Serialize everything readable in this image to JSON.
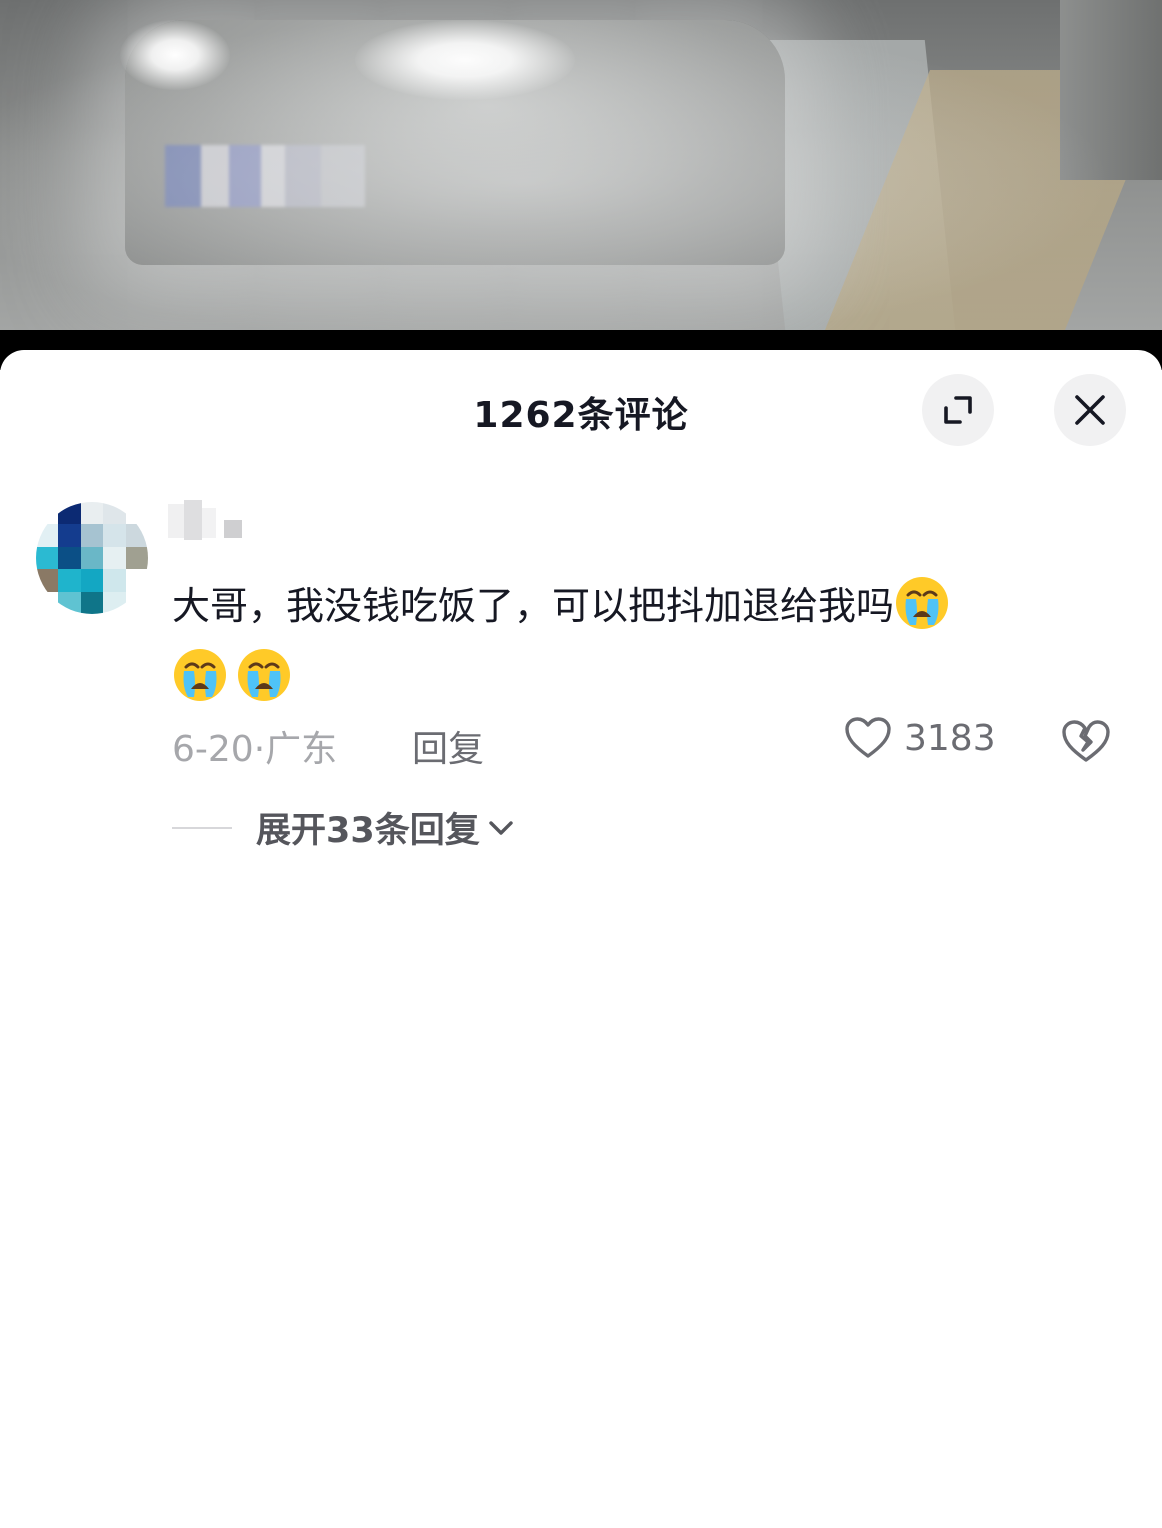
{
  "comments_panel": {
    "title": "1262条评论",
    "expand_icon": "expand-icon",
    "close_icon": "close-icon"
  },
  "comment": {
    "text": "大哥，我没钱吃饭了，可以把抖加退给我吗",
    "emoji": "loudly-crying-face",
    "date": "6-20",
    "separator": "·",
    "location": "广东",
    "reply_label": "回复",
    "like_count": "3183",
    "like_icon": "heart-icon",
    "dislike_icon": "broken-heart-icon"
  },
  "replies": {
    "expand_label": "展开33条回复",
    "chevron_icon": "chevron-down-icon"
  },
  "colors": {
    "title_text": "#161823",
    "meta_text": "#a6a7ab",
    "secondary_text": "#6b6c72",
    "button_bg": "#f1f1f2"
  }
}
